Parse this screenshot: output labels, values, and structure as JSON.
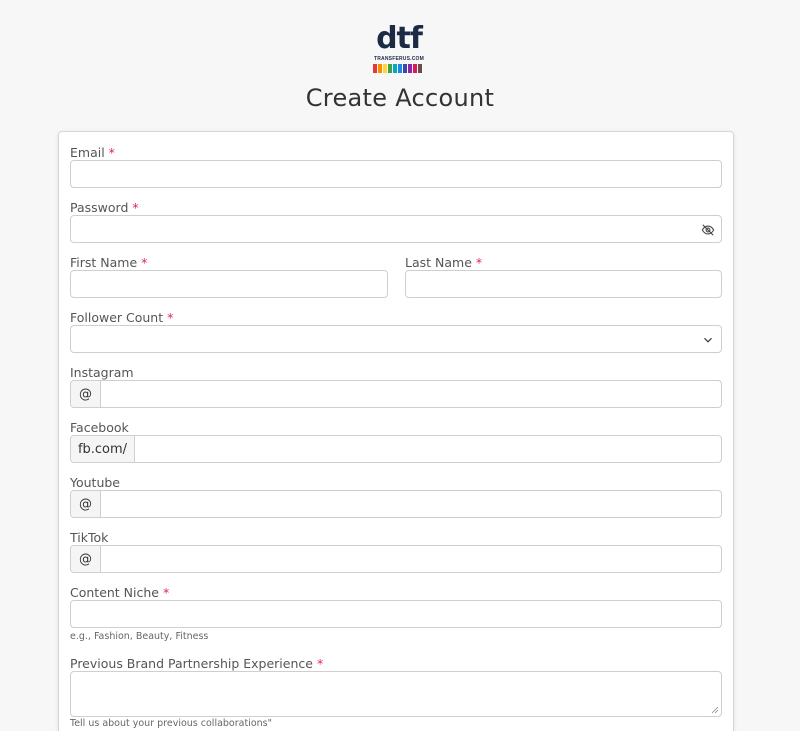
{
  "brand": {
    "logo_text": "dtf",
    "logo_subtext": "TRANSFERUS.COM",
    "bar_colors": [
      "#e53935",
      "#fb8c00",
      "#fdd835",
      "#43a047",
      "#00acc1",
      "#1e88e5",
      "#3949ab",
      "#8e24aa",
      "#d81b60",
      "#6d4c41"
    ]
  },
  "page": {
    "title": "Create Account"
  },
  "form": {
    "required_marker": "*",
    "email": {
      "label": "Email",
      "value": ""
    },
    "password": {
      "label": "Password",
      "value": "",
      "toggle_icon": "eye-off-icon"
    },
    "first_name": {
      "label": "First Name",
      "value": ""
    },
    "last_name": {
      "label": "Last Name",
      "value": ""
    },
    "follower_count": {
      "label": "Follower Count",
      "selected": "",
      "icon": "chevron-down-icon"
    },
    "instagram": {
      "label": "Instagram",
      "prefix": "@",
      "value": ""
    },
    "facebook": {
      "label": "Facebook",
      "prefix": "fb.com/",
      "value": ""
    },
    "youtube": {
      "label": "Youtube",
      "prefix": "@",
      "value": ""
    },
    "tiktok": {
      "label": "TikTok",
      "prefix": "@",
      "value": ""
    },
    "content_niche": {
      "label": "Content Niche",
      "value": "",
      "help": "e.g., Fashion, Beauty, Fitness"
    },
    "partnership": {
      "label": "Previous Brand Partnership Experience",
      "value": "",
      "help": "Tell us about your previous collaborations\""
    }
  }
}
